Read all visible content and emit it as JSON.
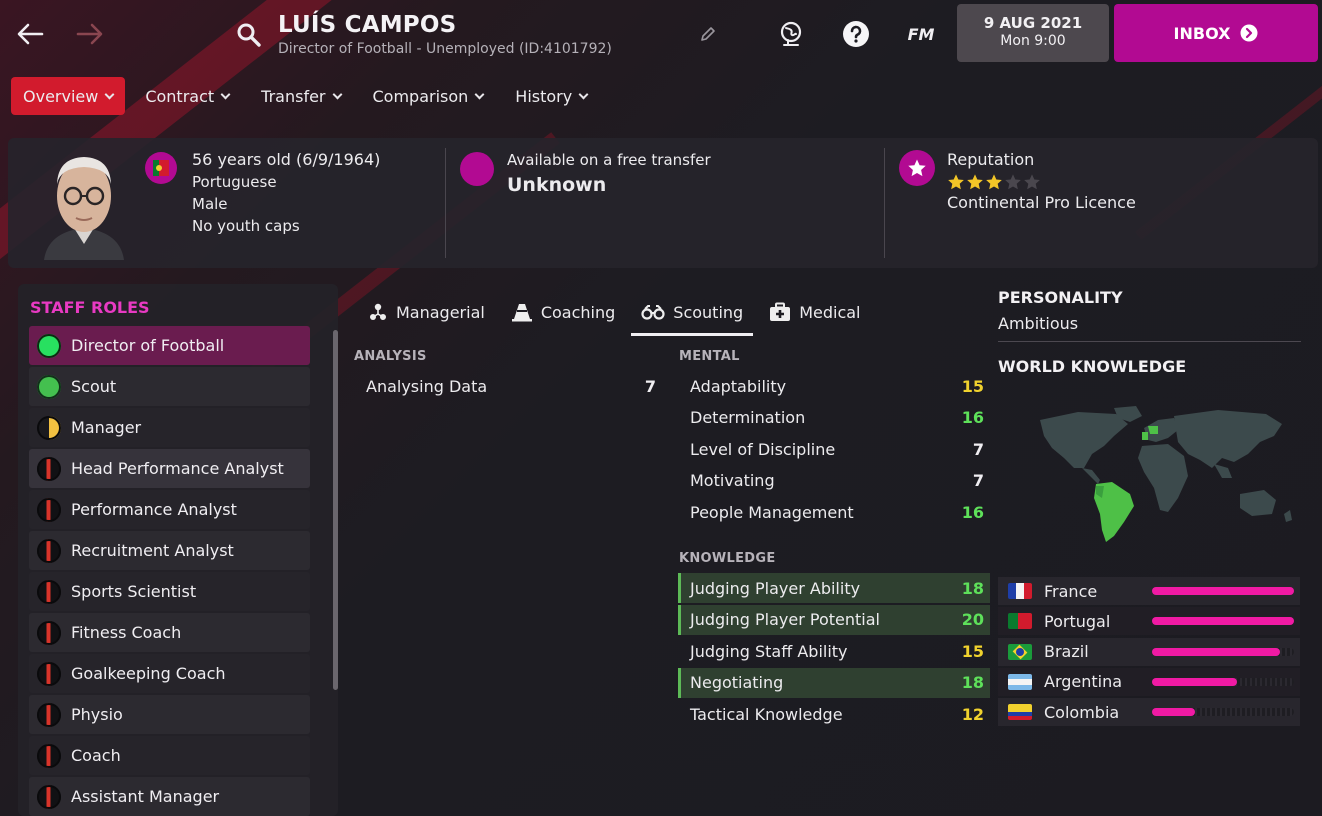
{
  "header": {
    "name": "LUÍS CAMPOS",
    "subtitle": "Director of Football - Unemployed (ID:4101792)",
    "fm_label": "FM",
    "date": "9 AUG 2021",
    "time": "Mon 9:00",
    "inbox_label": "INBOX"
  },
  "tabs": [
    {
      "label": "Overview"
    },
    {
      "label": "Contract"
    },
    {
      "label": "Transfer"
    },
    {
      "label": "Comparison"
    },
    {
      "label": "History"
    }
  ],
  "info": {
    "age": "56 years old (6/9/1964)",
    "nationality": "Portuguese",
    "gender": "Male",
    "caps": "No youth caps",
    "transfer_status": "Available on a free transfer",
    "transfer_value": "Unknown",
    "reputation_label": "Reputation",
    "reputation_stars": 3,
    "reputation_max": 5,
    "licence": "Continental Pro Licence"
  },
  "staff_roles": {
    "title": "STAFF ROLES",
    "items": [
      {
        "label": "Director of Football",
        "suitability": "full"
      },
      {
        "label": "Scout",
        "suitability": "high"
      },
      {
        "label": "Manager",
        "suitability": "half"
      },
      {
        "label": "Head Performance Analyst",
        "suitability": "low"
      },
      {
        "label": "Performance Analyst",
        "suitability": "low"
      },
      {
        "label": "Recruitment Analyst",
        "suitability": "low"
      },
      {
        "label": "Sports Scientist",
        "suitability": "low"
      },
      {
        "label": "Fitness Coach",
        "suitability": "low"
      },
      {
        "label": "Goalkeeping Coach",
        "suitability": "low"
      },
      {
        "label": "Physio",
        "suitability": "low"
      },
      {
        "label": "Coach",
        "suitability": "low"
      },
      {
        "label": "Assistant Manager",
        "suitability": "low"
      }
    ]
  },
  "sub_tabs": [
    {
      "label": "Managerial"
    },
    {
      "label": "Coaching"
    },
    {
      "label": "Scouting"
    },
    {
      "label": "Medical"
    }
  ],
  "analysis": {
    "title": "ANALYSIS",
    "rows": [
      {
        "label": "Analysing Data",
        "value": "7"
      }
    ]
  },
  "mental": {
    "title": "MENTAL",
    "rows": [
      {
        "label": "Adaptability",
        "value": "15"
      },
      {
        "label": "Determination",
        "value": "16"
      },
      {
        "label": "Level of Discipline",
        "value": "7"
      },
      {
        "label": "Motivating",
        "value": "7"
      },
      {
        "label": "People Management",
        "value": "16"
      }
    ]
  },
  "knowledge": {
    "title": "KNOWLEDGE",
    "rows": [
      {
        "label": "Judging Player Ability",
        "value": "18"
      },
      {
        "label": "Judging Player Potential",
        "value": "20"
      },
      {
        "label": "Judging Staff Ability",
        "value": "15"
      },
      {
        "label": "Negotiating",
        "value": "18"
      },
      {
        "label": "Tactical Knowledge",
        "value": "12"
      }
    ]
  },
  "personality": {
    "title": "PERSONALITY",
    "value": "Ambitious"
  },
  "world_knowledge": {
    "title": "WORLD KNOWLEDGE",
    "countries": [
      {
        "name": "France",
        "level": 1.0
      },
      {
        "name": "Portugal",
        "level": 1.0
      },
      {
        "name": "Brazil",
        "level": 0.9
      },
      {
        "name": "Argentina",
        "level": 0.6
      },
      {
        "name": "Colombia",
        "level": 0.3
      }
    ]
  },
  "colors": {
    "accent_red": "#d21b2d",
    "accent_magenta": "#b20a92",
    "bar_pink": "#f01aa4",
    "value_green": "#5ee05a",
    "value_yellow": "#f0d22e"
  }
}
